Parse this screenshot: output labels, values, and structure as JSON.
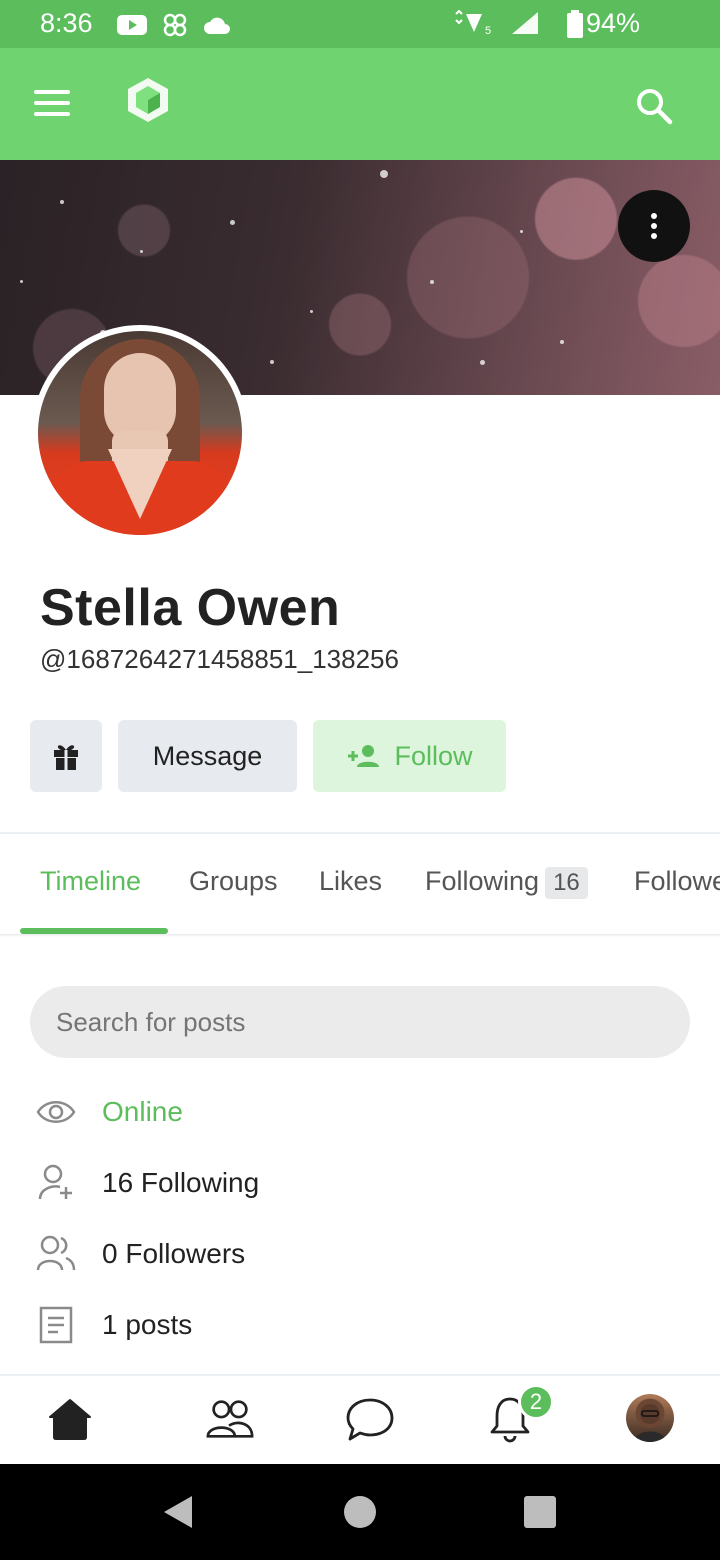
{
  "status_bar": {
    "time": "8:36",
    "battery": "94%"
  },
  "header": {
    "menu_icon": "hamburger-icon",
    "logo_icon": "cube-logo-icon",
    "search_icon": "search-icon",
    "accent_color": "#6fd46f"
  },
  "cover": {
    "menu_icon": "more-vertical-icon"
  },
  "profile": {
    "name": "Stella Owen",
    "handle": "@1687264271458851_138256"
  },
  "actions": {
    "gift_icon": "gift-icon",
    "message_label": "Message",
    "follow_label": "Follow",
    "follow_icon": "add-person-icon"
  },
  "tabs": [
    {
      "label": "Timeline",
      "active": true
    },
    {
      "label": "Groups"
    },
    {
      "label": "Likes"
    },
    {
      "label": "Following",
      "count": "16"
    },
    {
      "label": "Followers"
    }
  ],
  "search": {
    "placeholder": "Search for posts"
  },
  "stats": [
    {
      "icon": "eye-icon",
      "text": "Online"
    },
    {
      "icon": "person-add-icon",
      "text": "16 Following"
    },
    {
      "icon": "people-icon",
      "text": "0 Followers"
    },
    {
      "icon": "document-icon",
      "text": "1 posts"
    }
  ],
  "bottom_nav": {
    "items": [
      "home-icon",
      "groups-icon",
      "chat-icon",
      "bell-icon",
      "profile-avatar"
    ],
    "notification_count": "2"
  }
}
